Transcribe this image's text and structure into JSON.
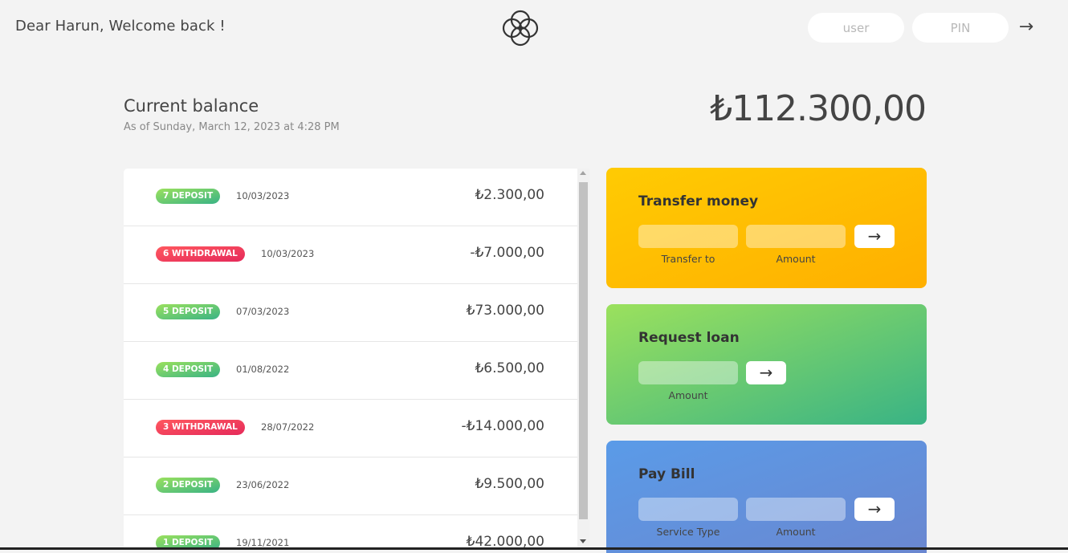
{
  "nav": {
    "welcome": "Dear Harun, Welcome back !",
    "user_placeholder": "user",
    "pin_placeholder": "PIN",
    "login_arrow": "→"
  },
  "balance": {
    "label": "Current balance",
    "date": "As of Sunday, March 12, 2023 at 4:28 PM",
    "value": "₺112.300,00"
  },
  "movements": [
    {
      "type": "7 deposit",
      "kind": "deposit",
      "date": "10/03/2023",
      "value": "₺2.300,00"
    },
    {
      "type": "6 withdrawal",
      "kind": "withdrawal",
      "date": "10/03/2023",
      "value": "-₺7.000,00"
    },
    {
      "type": "5 deposit",
      "kind": "deposit",
      "date": "07/03/2023",
      "value": "₺73.000,00"
    },
    {
      "type": "4 deposit",
      "kind": "deposit",
      "date": "01/08/2022",
      "value": "₺6.500,00"
    },
    {
      "type": "3 withdrawal",
      "kind": "withdrawal",
      "date": "28/07/2022",
      "value": "-₺14.000,00"
    },
    {
      "type": "2 deposit",
      "kind": "deposit",
      "date": "23/06/2022",
      "value": "₺9.500,00"
    },
    {
      "type": "1 deposit",
      "kind": "deposit",
      "date": "19/11/2021",
      "value": "₺42.000,00"
    }
  ],
  "operations": {
    "transfer": {
      "title": "Transfer money",
      "label_to": "Transfer to",
      "label_amount": "Amount",
      "button": "→"
    },
    "loan": {
      "title": "Request loan",
      "label_amount": "Amount",
      "button": "→"
    },
    "bill": {
      "title": "Pay Bill",
      "label_service": "Service Type",
      "label_amount": "Amount",
      "button": "→"
    }
  },
  "colors": {
    "deposit": "#39b385",
    "withdrawal": "#e52a5a",
    "transfer": "#ffb003",
    "loan": "#39b385",
    "bill": "#5a9be8"
  }
}
